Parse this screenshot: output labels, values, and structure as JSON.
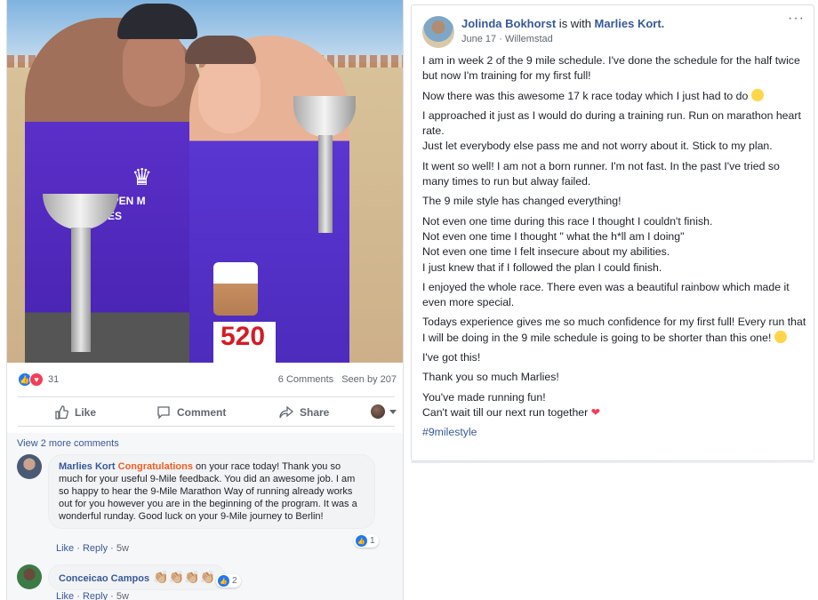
{
  "post": {
    "stats": {
      "reaction_count": "31",
      "comments": "6 Comments",
      "seen_by": "Seen by 207"
    },
    "photo_text": {
      "shirt": "ARDLOPEN M\nMARLIES",
      "bib": "520"
    },
    "actions": {
      "like": "Like",
      "comment": "Comment",
      "share": "Share"
    },
    "comments": {
      "view_more": "View 2 more comments",
      "items": [
        {
          "author": "Marlies Kort",
          "highlight": "Congratulations",
          "text": " on your race today! Thank you so much for your useful 9-Mile feedback. You did an awesome job. I am so happy to hear the 9-Mile Marathon Way of running already works out for you however you are in the beginning of the program. It was a wonderful runday. Good luck on your 9-Mile journey to Berlin!",
          "like": "Like",
          "reply": "Reply",
          "age": "5w",
          "reaction_count": "1"
        },
        {
          "author": "Conceicao Campos",
          "text": "👏🏼👏🏼👏🏼👏🏼",
          "like": "Like",
          "reply": "Reply",
          "age": "5w",
          "reaction_count": "2"
        }
      ]
    }
  },
  "detail": {
    "author": "Jolinda Bokhorst",
    "with_text": " is with ",
    "tagged": "Marlies Kort.",
    "date": "June 17",
    "location": "Willemstad",
    "more": "···",
    "paragraphs": [
      "I am in week 2 of the 9 mile schedule. I've done the schedule for the half twice but now I'm training for my first full!",
      "Now there was this awesome 17 k race today which I just had to do",
      "I approached it just as I would do during a training run. Run on marathon heart rate.\nJust let everybody else pass me and not worry about it. Stick to my plan.",
      "It went so well! I am not a born runner. I'm not fast. In the past I've tried so many times to run but alway failed.",
      "The 9 mile style has changed everything!",
      "Not even one time during this race I thought I couldn't finish.\nNot even one time I thought \" what the h*ll am I doing\"\nNot even one time I felt insecure about my abilities.\nI just knew that if I followed the plan I could finish.",
      "I enjoyed the whole race. There even was a beautiful rainbow which made it even more special.",
      "Todays experience gives me so much confidence for my first full! Every run that I will be doing in the 9 mile schedule is going to be shorter than this one!",
      "I've got this!",
      "Thank you so much Marlies!",
      "You've made running fun!\nCan't wait till our next run together"
    ],
    "hashtag": "#9milestyle"
  }
}
